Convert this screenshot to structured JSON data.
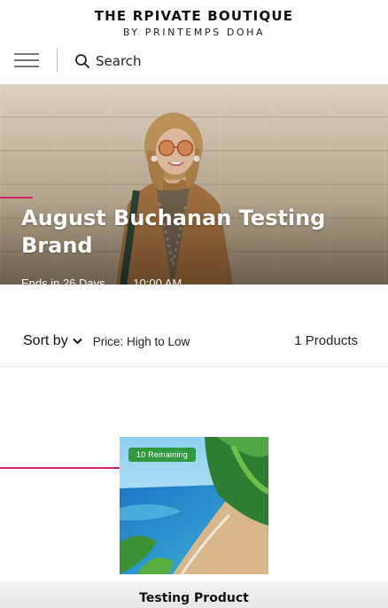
{
  "header": {
    "brand_title": "THE RPIVATE BOUTIQUE",
    "brand_subtitle": "BY PRINTEMPS DOHA",
    "menu_icon": "hamburger-menu-icon",
    "search_icon": "search-icon",
    "search_label": "Search"
  },
  "hero": {
    "title": "August Buchanan Testing Brand",
    "ends_text": "Ends in 26 Days",
    "time_text": "10:00 AM"
  },
  "listing": {
    "sort_label": "Sort by",
    "sort_icon": "chevron-down-icon",
    "sort_value": "Price: High to Low",
    "product_count": "1 Products"
  },
  "product": {
    "badge": "10 Remaining",
    "name": "Testing Product"
  },
  "colors": {
    "accent": "#d5246a",
    "badge_green": "#2e9a3d"
  }
}
